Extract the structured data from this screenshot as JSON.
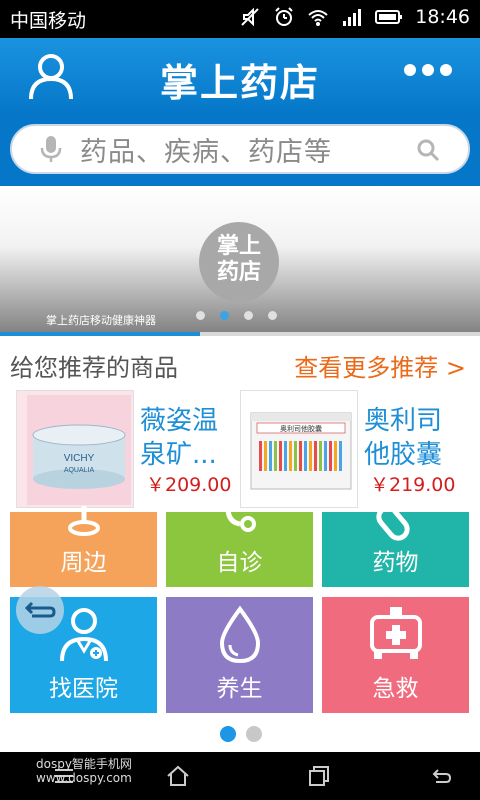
{
  "status_bar": {
    "carrier": "中国移动",
    "time": "18:46"
  },
  "header": {
    "title": "掌上药店"
  },
  "search": {
    "placeholder": "药品、疾病、药店等"
  },
  "banner": {
    "logo_text_line1": "掌上",
    "logo_text_line2": "药店",
    "caption": "掌上药店移动健康神器",
    "active_slide": 2,
    "slide_count": 4
  },
  "recommend": {
    "title": "给您推荐的商品",
    "more": "查看更多推荐 >",
    "products": [
      {
        "name": "薇姿温泉矿...",
        "price": "￥209.00",
        "image_text": "VICHY"
      },
      {
        "name": "奥利司他胶囊",
        "price": "￥219.00",
        "image_text": "奥利司他胶囊"
      }
    ]
  },
  "grid": {
    "tiles": [
      {
        "label": "周边",
        "color": "#f5a35a"
      },
      {
        "label": "自诊",
        "color": "#8cc63f"
      },
      {
        "label": "药物",
        "color": "#20b5a8"
      },
      {
        "label": "找医院",
        "color": "#1ea7e6"
      },
      {
        "label": "养生",
        "color": "#8d7bc6"
      },
      {
        "label": "急救",
        "color": "#f06b7e"
      }
    ]
  },
  "pager": {
    "active_page": 1,
    "page_count": 2
  },
  "watermark": {
    "line1": "dospy智能手机网",
    "line2": "www.dospy.com"
  }
}
